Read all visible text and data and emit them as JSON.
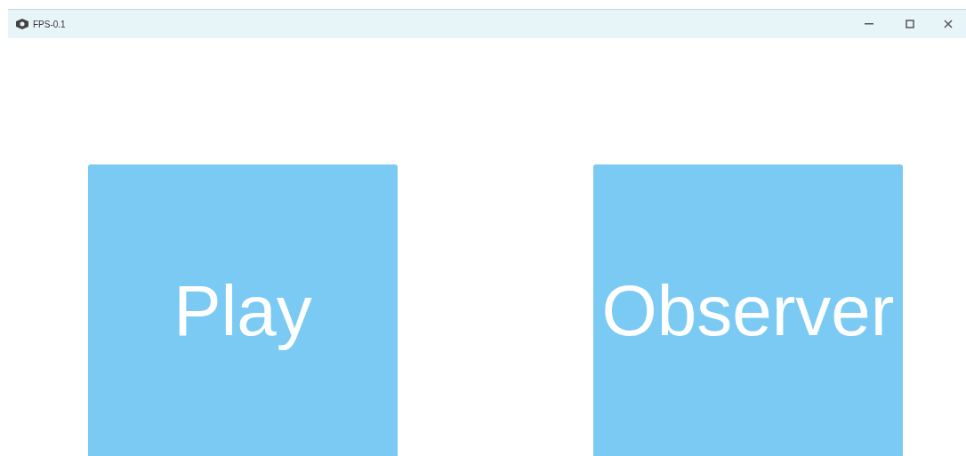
{
  "window": {
    "title": "FPS-0.1"
  },
  "buttons": [
    {
      "label": "Play"
    },
    {
      "label": "Observer"
    }
  ]
}
